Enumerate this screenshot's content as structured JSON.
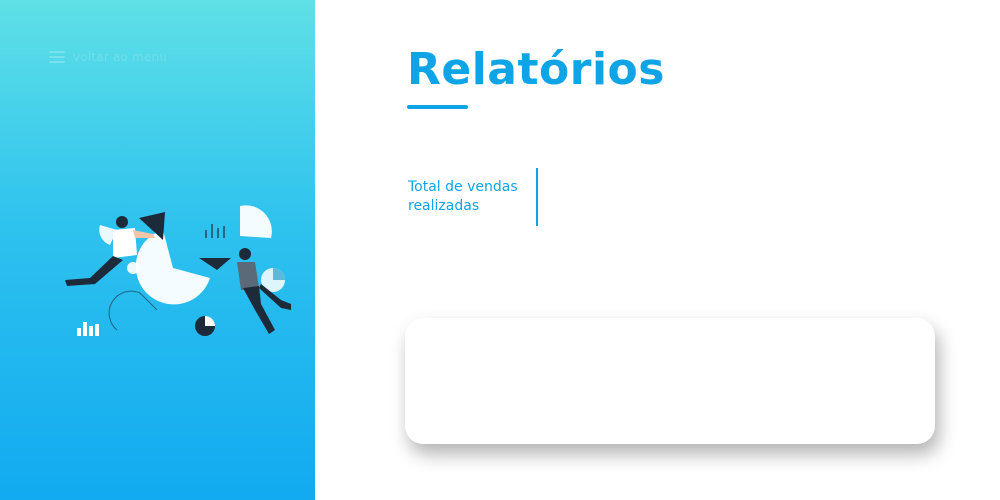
{
  "sidebar": {
    "back_menu_label": "voltar ao menu",
    "menu_icon": "hamburger-menu-icon",
    "illustration": "people-assembling-charts-illustration"
  },
  "main": {
    "title": "Relatórios",
    "stat": {
      "label": "Total de vendas realizadas"
    }
  },
  "colors": {
    "accent": "#0ea4e5",
    "sidebar_gradient_top": "#5fe0e6",
    "sidebar_gradient_bottom": "#12aaf0",
    "card_background": "#ffffff"
  }
}
